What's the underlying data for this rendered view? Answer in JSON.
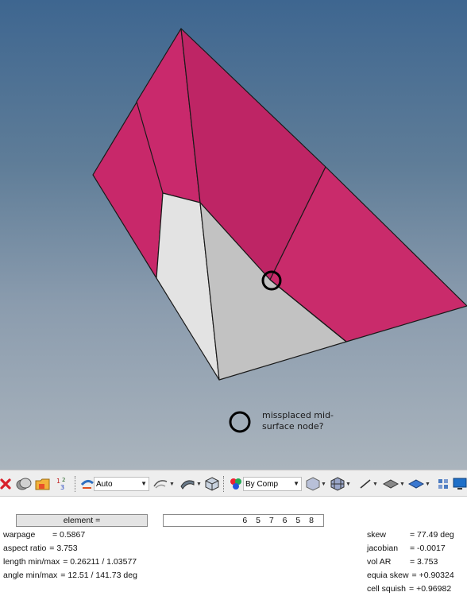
{
  "viewport": {
    "annotation": "missplaced mid-surface node?"
  },
  "toolbar": {
    "items": [
      {
        "icon": "delete-x-icon"
      },
      {
        "icon": "hide-elements-icon"
      },
      {
        "icon": "folder-icon"
      },
      {
        "icon": "numbers-icon"
      },
      {
        "icon": "shaded-auto-icon"
      },
      {
        "icon": "visual-style-icon"
      },
      {
        "icon": "surface-shading-icon"
      },
      {
        "icon": "cube-icon"
      },
      {
        "icon": "color-by-comp-icon"
      },
      {
        "icon": "solid-cube-icon"
      },
      {
        "icon": "mesh-cube-icon"
      },
      {
        "icon": "line-icon"
      },
      {
        "icon": "plane-icon"
      },
      {
        "icon": "blue-plane-icon"
      },
      {
        "icon": "grid-icon"
      },
      {
        "icon": "monitor-icon"
      }
    ],
    "auto_label": "Auto",
    "bycomp_label": "By Comp"
  },
  "panel": {
    "element_button": "element =",
    "element_ids": "6 5 7 6 5 8",
    "left": [
      {
        "key": "warpage",
        "value": "= 0.5867"
      },
      {
        "key": "aspect ratio",
        "value": "= 3.753"
      },
      {
        "key": "length min/max",
        "value": "= 0.26211 / 1.03577"
      },
      {
        "key": "angle min/max",
        "value": "= 12.51 / 141.73 deg"
      }
    ],
    "right": [
      {
        "key": "skew",
        "value": "= 77.49 deg"
      },
      {
        "key": "jacobian",
        "value": "= -0.0017"
      },
      {
        "key": "vol AR",
        "value": "= 3.753"
      },
      {
        "key": "equia skew",
        "value": "= +0.90324"
      },
      {
        "key": "cell squish",
        "value": "= +0.96982"
      }
    ]
  },
  "colors": {
    "magenta": "#c8286a",
    "grey_face": "#c4c4c4",
    "light_face": "#e2e2e2"
  }
}
